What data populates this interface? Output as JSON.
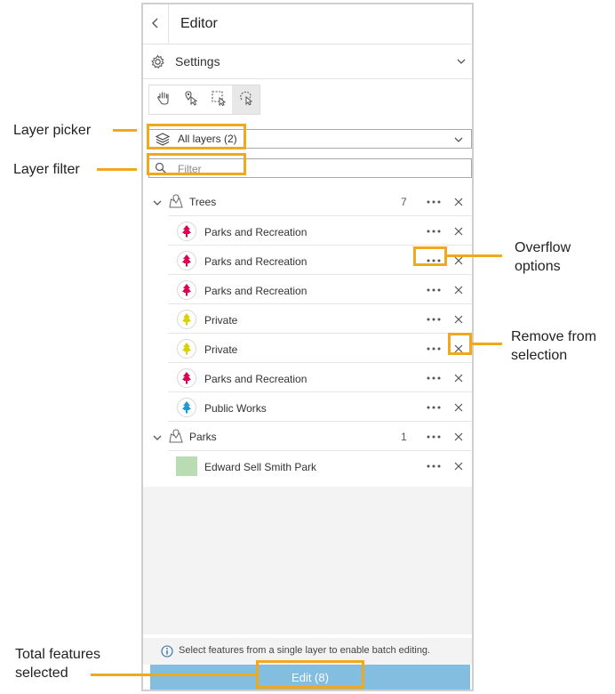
{
  "editor": {
    "title": "Editor",
    "back_icon": "chevron-left-icon",
    "settings_label": "Settings",
    "layer_picker_value": "All layers (2)",
    "filter_placeholder": "Filter",
    "groups": [
      {
        "name": "Trees",
        "count": "7",
        "features": [
          {
            "name": "Parks and Recreation",
            "color": "#e0004f"
          },
          {
            "name": "Parks and Recreation",
            "color": "#e0004f"
          },
          {
            "name": "Parks and Recreation",
            "color": "#e0004f"
          },
          {
            "name": "Private",
            "color": "#d9d200"
          },
          {
            "name": "Private",
            "color": "#d9d200"
          },
          {
            "name": "Parks and Recreation",
            "color": "#e0004f"
          },
          {
            "name": "Public Works",
            "color": "#1a9ad8"
          }
        ]
      },
      {
        "name": "Parks",
        "count": "1",
        "features": [
          {
            "name": "Edward Sell Smith Park",
            "color": "#b9dcb2"
          }
        ]
      }
    ],
    "info_text": "Select features from a single layer to enable batch editing.",
    "edit_button": "Edit (8)"
  },
  "callouts": {
    "layer_picker": "Layer picker",
    "layer_filter": "Layer filter",
    "overflow_line1": "Overflow",
    "overflow_line2": "options",
    "remove_line1": "Remove from",
    "remove_line2": "selection",
    "total_line1": "Total features",
    "total_line2": "selected"
  },
  "colors": {
    "accent": "#f0a81c",
    "edit_button": "#83bde0"
  }
}
